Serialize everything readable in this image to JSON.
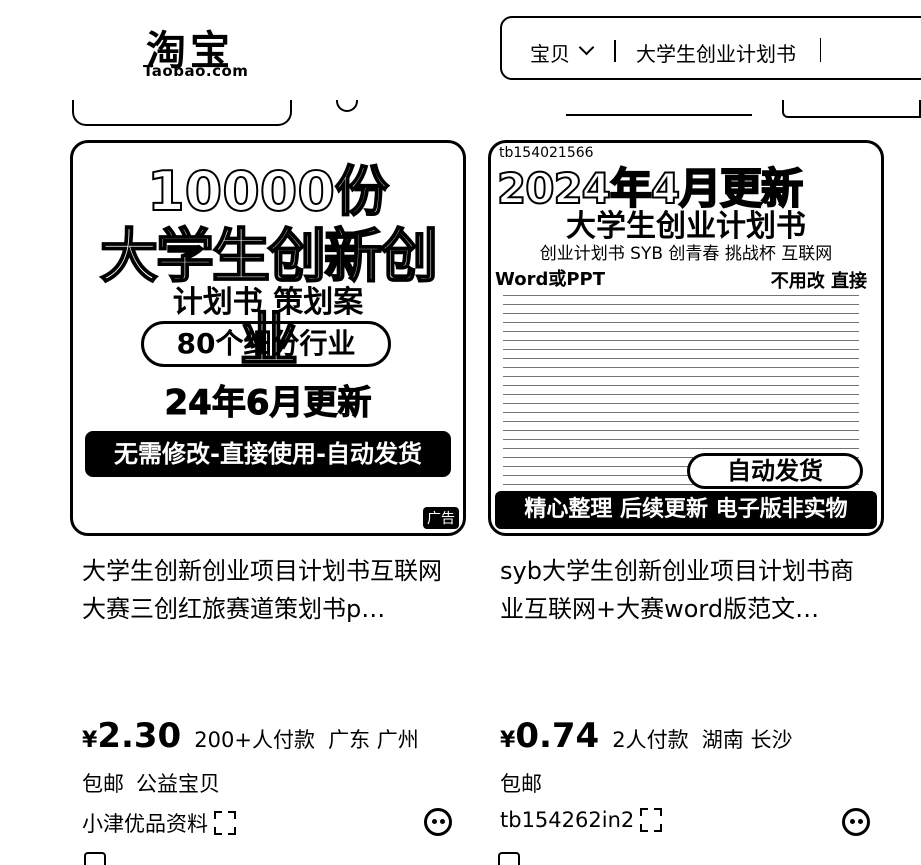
{
  "header": {
    "logo_cn": "淘宝",
    "logo_en": "Taobao.com"
  },
  "search": {
    "category": "宝贝",
    "query": "大学生创业计划书"
  },
  "products": [
    {
      "title": "大学生创新创业项目计划书互联网大赛三创红旅赛道策划书p…",
      "price_symbol": "¥",
      "price": "2.30",
      "sales": "200+人付款",
      "location": "广东 广州",
      "tags": [
        "包邮",
        "公益宝贝"
      ],
      "shop": "小津优品资料",
      "image": {
        "headline": "10000份",
        "main": "大学生创新创业",
        "sub": "计划书 策划案",
        "boxed": "80个细分行业",
        "date": "24年6月更新",
        "band": "无需修改-直接使用-自动发货",
        "ad": "广告"
      }
    },
    {
      "title": "syb大学生创新创业项目计划书商业互联网+大赛word版范文…",
      "price_symbol": "¥",
      "price": "0.74",
      "sales": "2人付款",
      "location": "湖南 长沙",
      "tags": [
        "包邮"
      ],
      "shop": "tb154262in2",
      "image": {
        "watermark": "tb154021566",
        "year": "2024年4月更新",
        "title": "大学生创业计划书",
        "tags": "创业计划书 SYB 创青春 挑战杯 互联网",
        "word": "Word或PPT",
        "noedit": "不用改 直接",
        "auto": "自动发货",
        "band": "精心整理 后续更新 电子版非实物"
      }
    }
  ]
}
